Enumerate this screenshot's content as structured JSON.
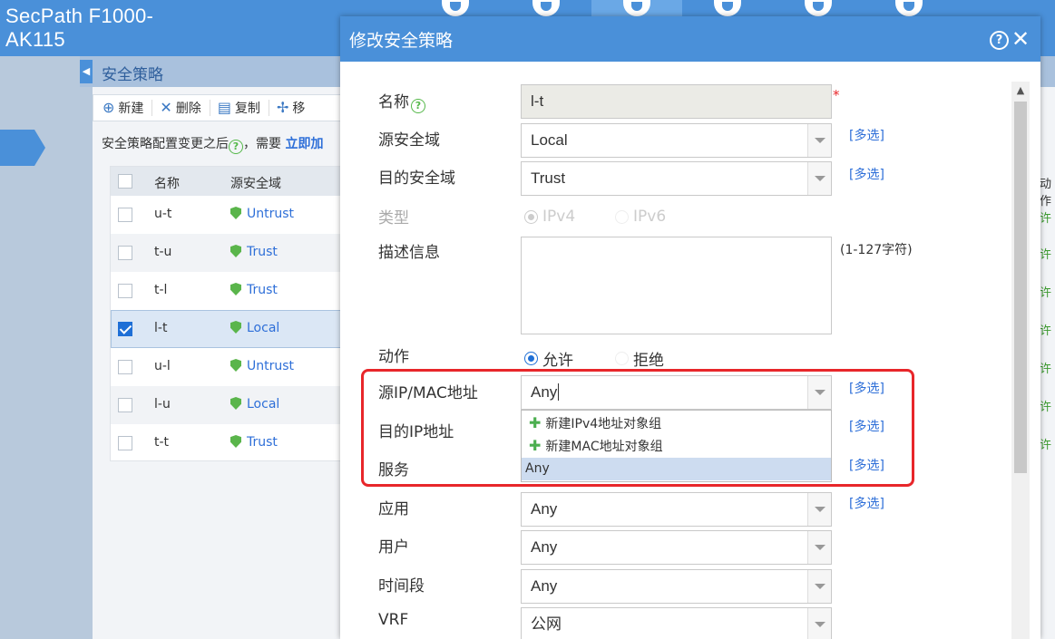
{
  "header": {
    "brand": "SecPath F1000-\nAK115",
    "top_icons": [
      "monitor-icon",
      "camera-icon",
      "shield-plus-icon",
      "share-icon",
      "globe-icon",
      "desktop-icon"
    ]
  },
  "page": {
    "tab_title": "安全策略",
    "toolbar": {
      "new": "新建",
      "delete": "删除",
      "copy": "复制",
      "move": "移"
    },
    "notice_text": "安全策略配置变更之后",
    "notice_suffix": "，需要",
    "notice_link": "立即加",
    "grid": {
      "columns": [
        "名称",
        "源安全域"
      ],
      "rows": [
        {
          "name": "u-t",
          "zone": "Untrust",
          "checked": false
        },
        {
          "name": "t-u",
          "zone": "Trust",
          "checked": false
        },
        {
          "name": "t-l",
          "zone": "Trust",
          "checked": false
        },
        {
          "name": "l-t",
          "zone": "Local",
          "checked": true
        },
        {
          "name": "u-l",
          "zone": "Untrust",
          "checked": false
        },
        {
          "name": "l-u",
          "zone": "Local",
          "checked": false
        },
        {
          "name": "t-t",
          "zone": "Trust",
          "checked": false
        }
      ],
      "right_col_header": "动作",
      "right_col_values": [
        "许",
        "许",
        "许",
        "许",
        "许",
        "许",
        "许"
      ]
    }
  },
  "dialog": {
    "title": "修改安全策略",
    "help": "?",
    "close": "✕",
    "fields": {
      "name": {
        "label": "名称",
        "value": "l-t",
        "required_mark": "*"
      },
      "src_zone": {
        "label": "源安全域",
        "value": "Local",
        "multi": "[多选]"
      },
      "dst_zone": {
        "label": "目的安全域",
        "value": "Trust",
        "multi": "[多选]"
      },
      "type": {
        "label": "类型",
        "options": [
          "IPv4",
          "IPv6"
        ],
        "selected": "IPv4"
      },
      "description": {
        "label": "描述信息",
        "value": "",
        "hint": "(1-127字符)"
      },
      "action": {
        "label": "动作",
        "options": [
          "允许",
          "拒绝"
        ],
        "selected": "允许"
      },
      "src_ip": {
        "label": "源IP/MAC地址",
        "value": "Any",
        "multi": "[多选]"
      },
      "dst_ip": {
        "label": "目的IP地址",
        "multi": "[多选]"
      },
      "service": {
        "label": "服务",
        "multi": "[多选]"
      },
      "app": {
        "label": "应用",
        "value": "Any",
        "multi": "[多选]"
      },
      "user": {
        "label": "用户",
        "value": "Any"
      },
      "time": {
        "label": "时间段",
        "value": "Any"
      },
      "vrf": {
        "label": "VRF",
        "value": "公网"
      }
    },
    "dropdown": {
      "items": [
        "新建IPv4地址对象组",
        "新建MAC地址对象组"
      ],
      "highlighted": "Any"
    }
  },
  "colors": {
    "header_blue": "#4a90d9",
    "highlight_red": "#e8262a",
    "link_blue": "#2e6fd8",
    "accent_green": "#5ab54b"
  }
}
